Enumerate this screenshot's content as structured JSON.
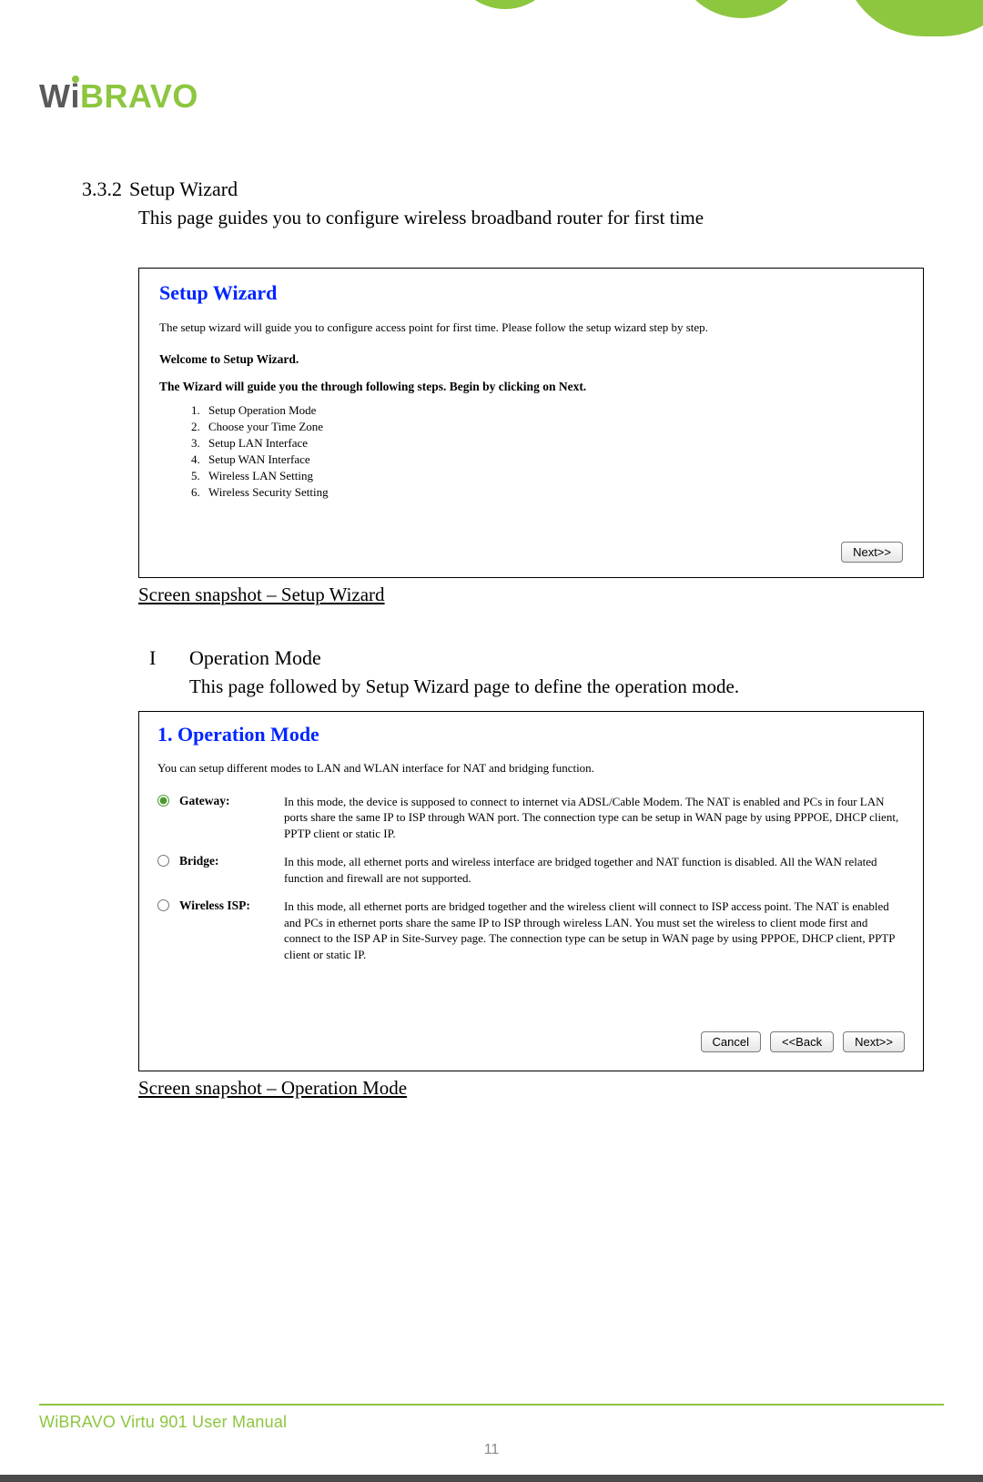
{
  "logo": {
    "part1": "W",
    "part2": "i",
    "part3": "BRAVO"
  },
  "section": {
    "number": "3.3.2",
    "title": "Setup Wizard",
    "description": "This page guides you to configure wireless broadband router for first time"
  },
  "wizard": {
    "title": "Setup Wizard",
    "intro": "The setup wizard will guide you to configure access point for first time. Please follow the setup wizard step by step.",
    "welcome": "Welcome to Setup Wizard.",
    "guide": "The Wizard will guide you the through following steps. Begin by clicking on Next.",
    "steps": [
      "Setup Operation Mode",
      "Choose your Time Zone",
      "Setup LAN Interface",
      "Setup WAN Interface",
      "Wireless LAN Setting",
      "Wireless Security Setting"
    ],
    "next_label": "Next>>"
  },
  "caption1": "Screen snapshot – Setup Wizard",
  "subsection": {
    "letter": "I",
    "title": "Operation Mode",
    "description": "This page followed by Setup Wizard page to define the operation mode."
  },
  "opmode": {
    "title": "1. Operation Mode",
    "intro": "You can setup different modes to LAN and WLAN interface for NAT and bridging function.",
    "options": [
      {
        "label": "Gateway:",
        "checked": true,
        "text": "In this mode, the device is supposed to connect to internet via ADSL/Cable Modem. The NAT is enabled and PCs in four LAN ports share the same IP to ISP through WAN port. The connection type can be setup in WAN page by using PPPOE, DHCP client, PPTP client or static IP."
      },
      {
        "label": "Bridge:",
        "checked": false,
        "text": "In this mode, all ethernet ports and wireless interface are bridged together and NAT function is disabled. All the WAN related function and firewall are not supported."
      },
      {
        "label": "Wireless ISP:",
        "checked": false,
        "text": "In this mode, all ethernet ports are bridged together and the wireless client will connect to ISP access point. The NAT is enabled and PCs in ethernet ports share the same IP to ISP through wireless LAN. You must set the wireless to client mode first and connect to the ISP AP in Site-Survey page. The connection type can be setup in WAN page by using PPPOE, DHCP client, PPTP client or static IP."
      }
    ],
    "cancel_label": "Cancel",
    "back_label": "<<Back",
    "next_label": "Next>>"
  },
  "caption2": "Screen snapshot – Operation Mode",
  "footer": {
    "text": "WiBRAVO Virtu 901 User Manual",
    "page": "11"
  }
}
